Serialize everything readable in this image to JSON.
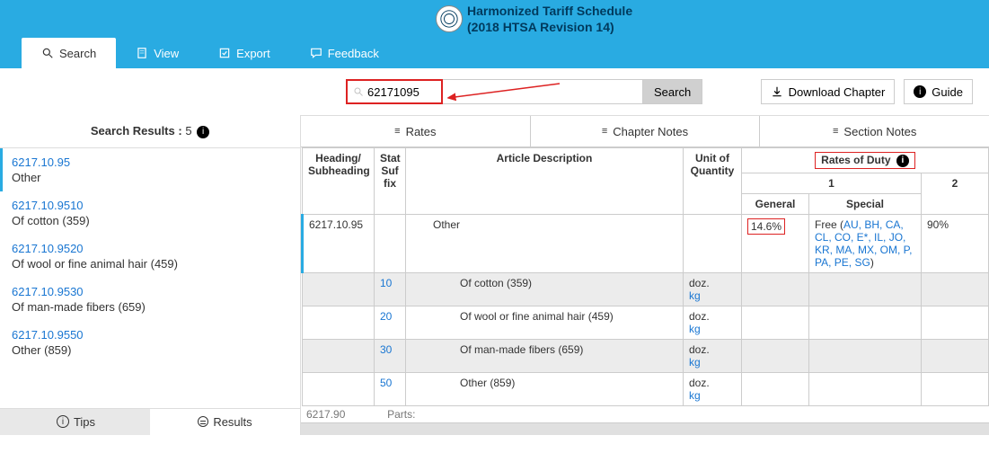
{
  "header": {
    "title": "Harmonized Tariff Schedule",
    "subtitle": "(2018 HTSA Revision 14)"
  },
  "mainTabs": {
    "search": "Search",
    "view": "View",
    "export": "Export",
    "feedback": "Feedback"
  },
  "search": {
    "value": "62171095",
    "button": "Search"
  },
  "toolbar": {
    "download": "Download Chapter",
    "guide": "Guide"
  },
  "resultsHeader": {
    "prefix": "Search Results : ",
    "count": "5"
  },
  "results": [
    {
      "code": "6217.10.95",
      "desc": "Other"
    },
    {
      "code": "6217.10.9510",
      "desc": "Of cotton (359)"
    },
    {
      "code": "6217.10.9520",
      "desc": "Of wool or fine animal hair (459)"
    },
    {
      "code": "6217.10.9530",
      "desc": "Of man-made fibers (659)"
    },
    {
      "code": "6217.10.9550",
      "desc": "Other (859)"
    }
  ],
  "bottomTabs": {
    "tips": "Tips",
    "results": "Results"
  },
  "subTabs": {
    "rates": "Rates",
    "chapter": "Chapter Notes",
    "section": "Section Notes"
  },
  "tableHeaders": {
    "heading": "Heading/ Subheading",
    "suffix": "Stat Suf fix",
    "article": "Article Description",
    "unit": "Unit of Quantity",
    "ratesOfDuty": "Rates of Duty",
    "one": "1",
    "general": "General",
    "special": "Special",
    "two": "2"
  },
  "row0": {
    "code": "6217.10.95",
    "desc": "Other",
    "general": "14.6%",
    "specialPrefix": "Free (",
    "specialCodes": "AU, BH, CA, CL, CO, E*, IL, JO, KR, MA, MX, OM, P, PA, PE, SG",
    "specialSuffix": ")",
    "col2": "90%"
  },
  "rows": [
    {
      "suffix": "10",
      "desc": "Of cotton (359)",
      "unit1": "doz.",
      "unit2": "kg"
    },
    {
      "suffix": "20",
      "desc": "Of wool or fine animal hair (459)",
      "unit1": "doz.",
      "unit2": "kg"
    },
    {
      "suffix": "30",
      "desc": "Of man-made fibers (659)",
      "unit1": "doz.",
      "unit2": "kg"
    },
    {
      "suffix": "50",
      "desc": "Other (859)",
      "unit1": "doz.",
      "unit2": "kg"
    }
  ],
  "peek": {
    "code": "6217.90",
    "desc": "Parts:"
  }
}
